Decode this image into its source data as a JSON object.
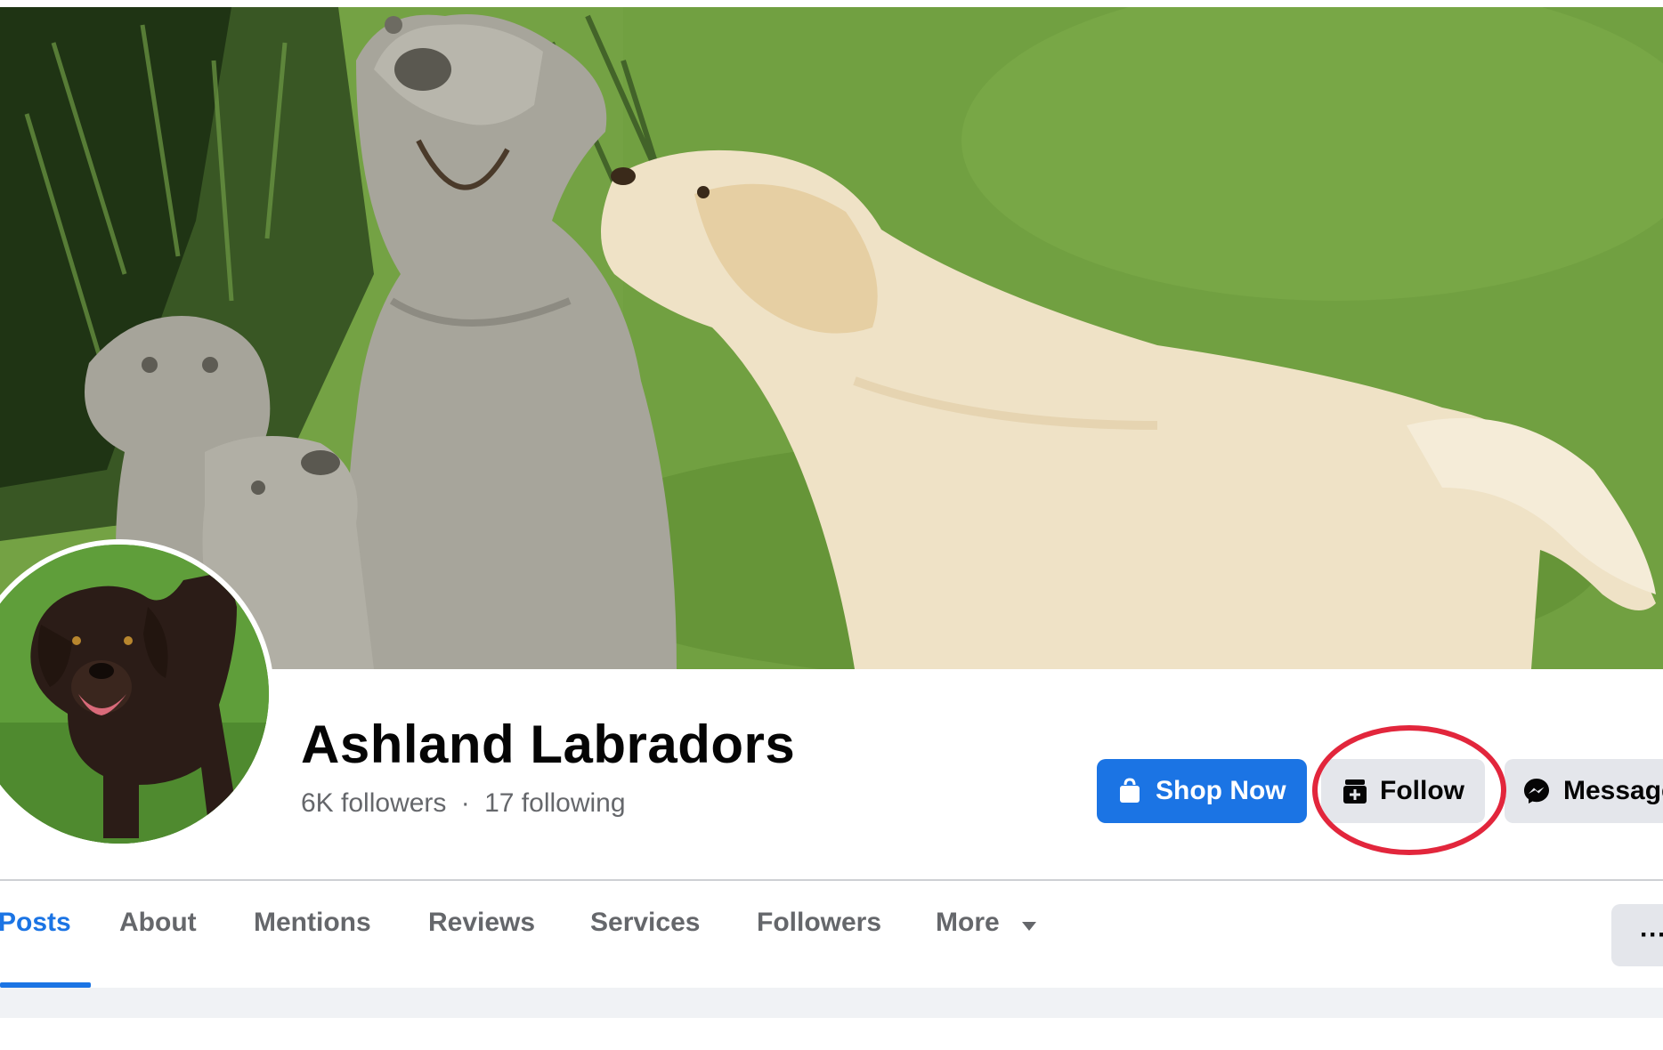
{
  "page": {
    "name": "Ashland Labradors",
    "followers": "6K followers",
    "separator": "·",
    "following": "17 following"
  },
  "actions": {
    "shop_now": "Shop Now",
    "follow": "Follow",
    "message": "Message"
  },
  "tabs": [
    {
      "label": "Posts",
      "active": true
    },
    {
      "label": "About"
    },
    {
      "label": "Mentions"
    },
    {
      "label": "Reviews"
    },
    {
      "label": "Services"
    },
    {
      "label": "Followers"
    },
    {
      "label": "More"
    }
  ],
  "more_menu": "···",
  "colors": {
    "primary": "#1b74e4",
    "secondary_button": "#e4e6eb",
    "highlight_ring": "#e2263c",
    "muted_text": "#65676b"
  },
  "icons": {
    "shop": "shopping-bag-icon",
    "follow": "follow-plus-icon",
    "message": "messenger-icon",
    "more": "caret-down-icon"
  }
}
